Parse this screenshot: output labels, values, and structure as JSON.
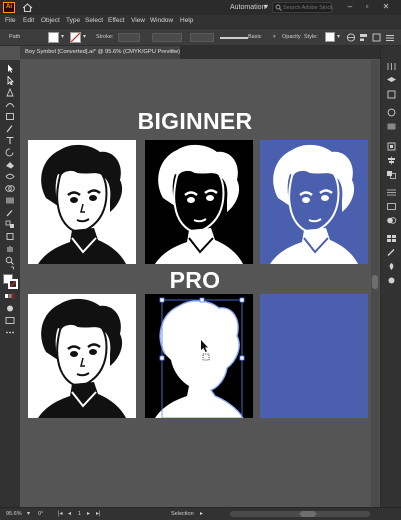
{
  "appbar": {
    "logo_text": "Ai",
    "workspace": "Automation",
    "search_placeholder": "Search Adobe Stock",
    "window_controls": [
      "minimize-icon",
      "maximize-icon",
      "close-icon"
    ]
  },
  "menu": [
    "File",
    "Edit",
    "Object",
    "Type",
    "Select",
    "Effect",
    "View",
    "Window",
    "Help"
  ],
  "controlbar": {
    "selection_label": "Path",
    "stroke_label": "Stroke:",
    "brush_label": "Basic",
    "opacity_label": "Opacity",
    "style_label": "Style:"
  },
  "document": {
    "tab_title": "Boy Symbol [Converted].ai* @ 95.6% (CMYK/GPU Preview)",
    "close": "×"
  },
  "canvas": {
    "heading_top": "BIGINNER",
    "heading_bottom": "PRO",
    "colors": {
      "white_panel": "#ffffff",
      "black_panel": "#000000",
      "blue_panel": "#4a5fae",
      "selection": "#5a80ff"
    }
  },
  "status": {
    "zoom": "95.6%",
    "rotation": "0°",
    "artboard": "1",
    "tool": "Selection"
  }
}
